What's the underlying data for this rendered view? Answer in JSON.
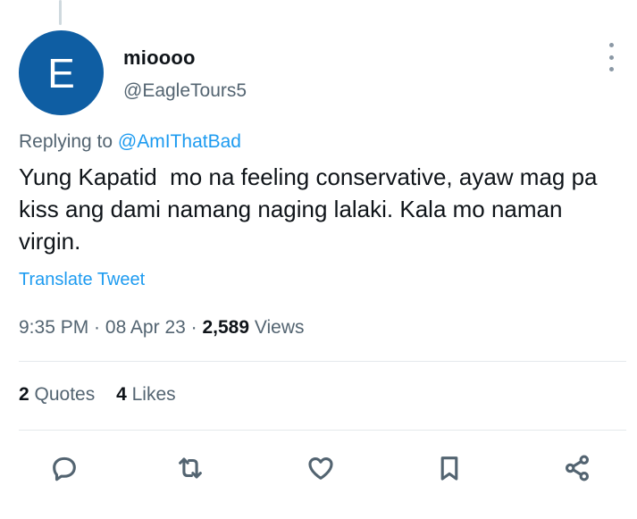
{
  "author": {
    "avatar_letter": "E",
    "avatar_color": "#0f5ea3",
    "display_name": "mioooo",
    "handle": "@EagleTours5"
  },
  "reply": {
    "prefix": "Replying to ",
    "to_handle": "@AmIThatBad"
  },
  "tweet": {
    "text": "Yung Kapatid  mo na feeling conservative, ayaw mag pa kiss ang dami namang naging lalaki. Kala mo naman virgin.",
    "translate_label": "Translate Tweet"
  },
  "meta": {
    "time": "9:35 PM",
    "separator": " · ",
    "date": "08 Apr 23",
    "views_count": "2,589",
    "views_label": " Views"
  },
  "stats": {
    "quotes_count": "2",
    "quotes_label": " Quotes",
    "likes_count": "4",
    "likes_label": " Likes"
  },
  "actions": [
    {
      "icon": "reply-icon"
    },
    {
      "icon": "retweet-icon"
    },
    {
      "icon": "like-icon"
    },
    {
      "icon": "bookmark-icon"
    },
    {
      "icon": "share-icon"
    }
  ],
  "colors": {
    "accent": "#1d9bf0",
    "secondary_text": "#536471",
    "primary_text": "#0f1419"
  }
}
